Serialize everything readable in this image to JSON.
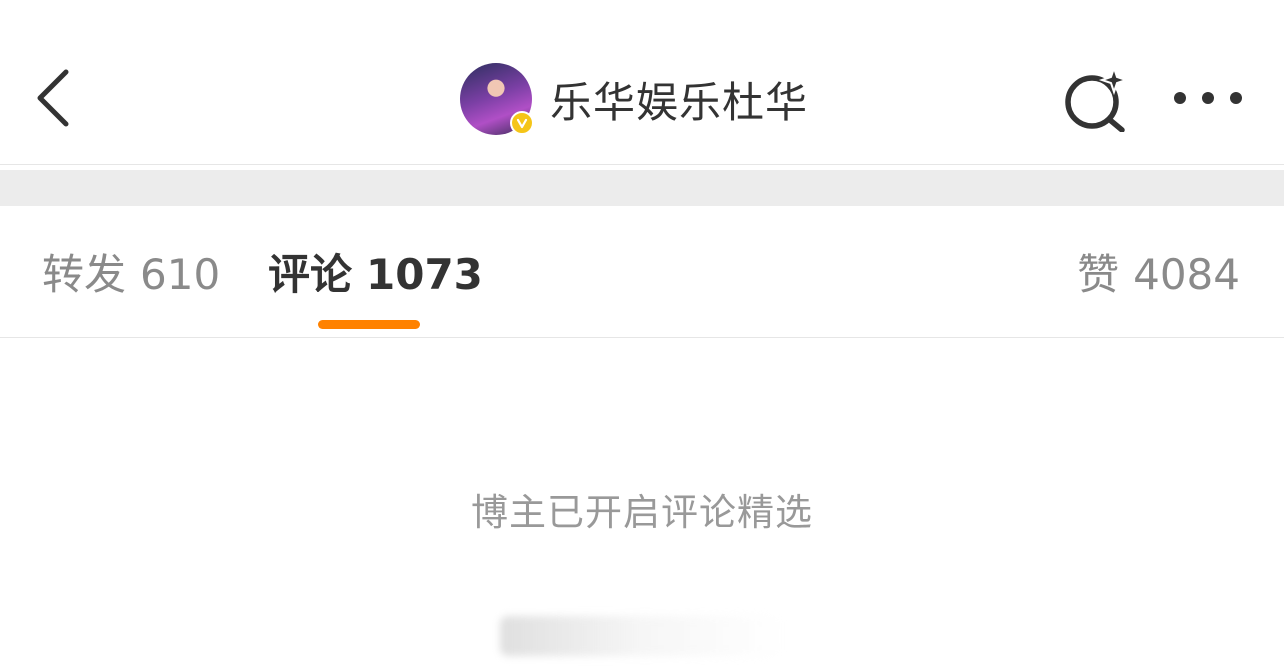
{
  "header": {
    "title": "乐华娱乐杜华",
    "back_icon": "chevron-left-icon",
    "search_icon": "search-sparkle-icon",
    "more_icon": "more-horizontal-icon",
    "verified_badge_color": "#f5c518"
  },
  "tabs": [
    {
      "label": "转发",
      "count": "610",
      "active": false
    },
    {
      "label": "评论",
      "count": "1073",
      "active": true
    },
    {
      "label": "赞",
      "count": "4084",
      "active": false
    }
  ],
  "accent_color": "#ff8200",
  "content": {
    "notice": "博主已开启评论精选"
  }
}
